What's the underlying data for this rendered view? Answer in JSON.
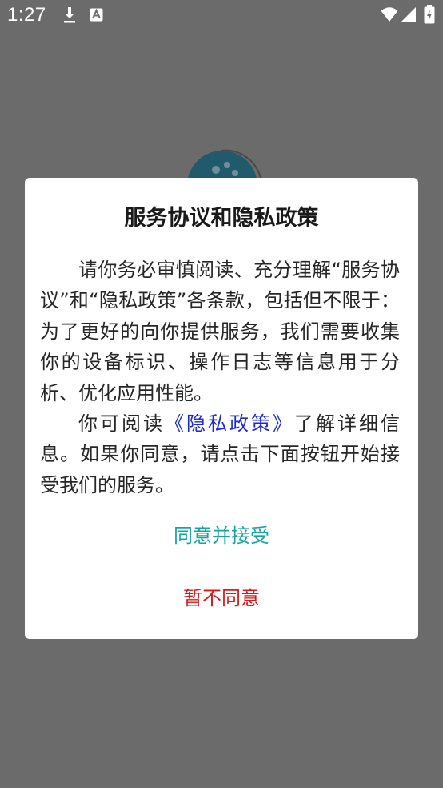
{
  "status_bar": {
    "time": "1:27",
    "icons": [
      "download-icon",
      "a-icon",
      "wifi-icon",
      "signal-icon",
      "battery-icon"
    ]
  },
  "dialog": {
    "title": "服务协议和隐私政策",
    "paragraph1": "请你务必审慎阅读、充分理解“服务协议”和“隐私政策”各条款，包括但不限于：为了更好的向你提供服务，我们需要收集你的设备标识、操作日志等信息用于分析、优化应用性能。",
    "paragraph2_before": "你可阅读",
    "privacy_link": "《隐私政策》",
    "paragraph2_after": "了解详细信息。如果你同意，请点击下面按钮开始接受我们的服务。",
    "agree_label": "同意并接受",
    "disagree_label": "暂不同意"
  },
  "colors": {
    "overlay": "#6b6b6b",
    "link": "#1b2ad3",
    "agree": "#15a4a4",
    "disagree": "#e01515"
  }
}
